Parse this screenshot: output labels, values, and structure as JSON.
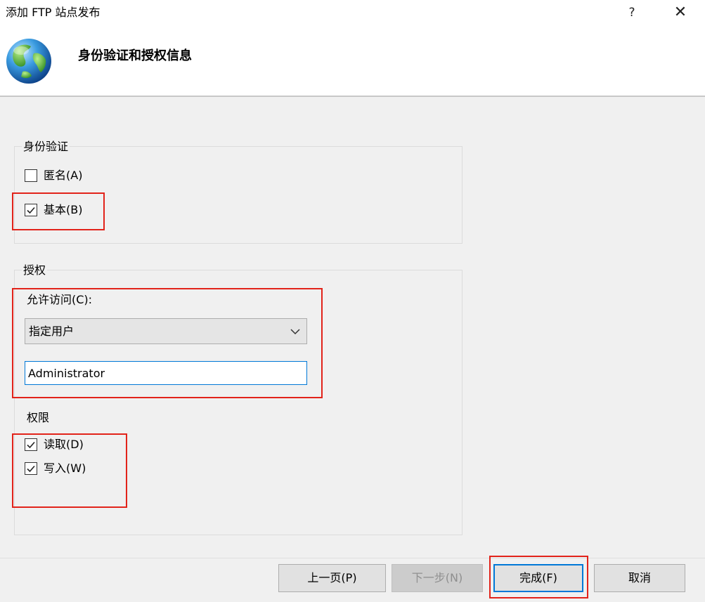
{
  "window": {
    "title": "添加 FTP 站点发布",
    "help_glyph": "?",
    "close_glyph": "✕"
  },
  "header": {
    "heading": "身份验证和授权信息",
    "icon": "globe-icon"
  },
  "authentication": {
    "group_title": "身份验证",
    "anonymous": {
      "label": "匿名(A)",
      "checked": false
    },
    "basic": {
      "label": "基本(B)",
      "checked": true
    }
  },
  "authorization": {
    "group_title": "授权",
    "allow_access_label": "允许访问(C):",
    "allow_access_selected": "指定用户",
    "user_value": "Administrator",
    "permissions_label": "权限",
    "read": {
      "label": "读取(D)",
      "checked": true
    },
    "write": {
      "label": "写入(W)",
      "checked": true
    }
  },
  "footer": {
    "previous_label": "上一页(P)",
    "next_label": "下一步(N)",
    "finish_label": "完成(F)",
    "cancel_label": "取消"
  },
  "colors": {
    "highlight_red": "#e2231a",
    "focus_blue": "#0078d7",
    "dialog_background": "#f0f0f0"
  }
}
